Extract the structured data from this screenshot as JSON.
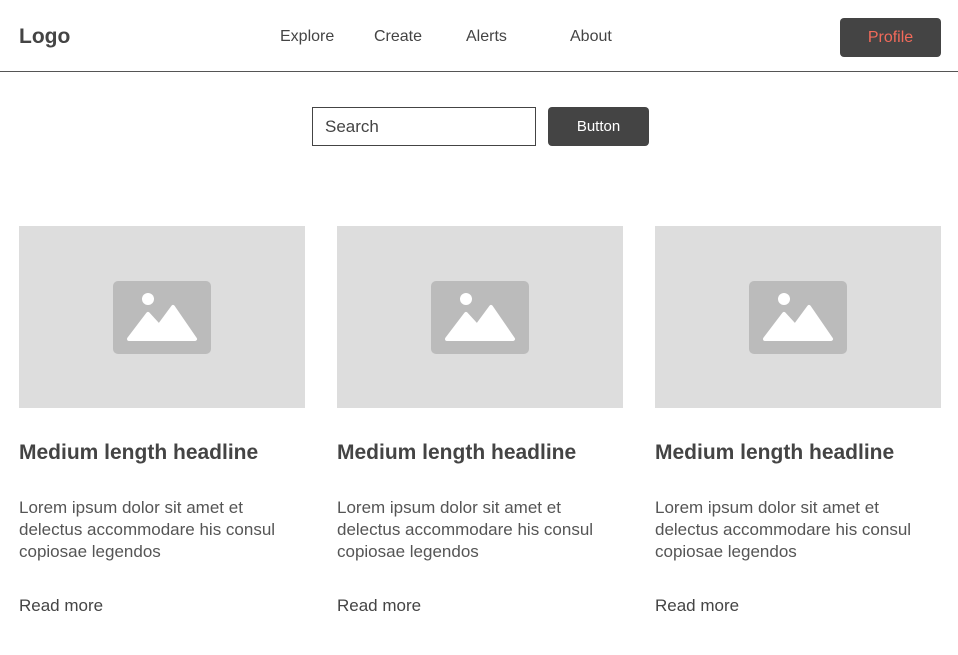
{
  "header": {
    "logo": "Logo",
    "nav": [
      "Explore",
      "Create",
      "Alerts",
      "About"
    ],
    "profile_label": "Profile"
  },
  "search": {
    "placeholder": "Search",
    "button_label": "Button"
  },
  "cards": [
    {
      "title": "Medium length headline",
      "body": "Lorem ipsum dolor sit amet et delectus accommodare his consul copiosae legendos",
      "link": "Read more",
      "image_icon": "image-placeholder-icon"
    },
    {
      "title": "Medium length headline",
      "body": "Lorem ipsum dolor sit amet et delectus accommodare his consul copiosae legendos",
      "link": "Read more",
      "image_icon": "image-placeholder-icon"
    },
    {
      "title": "Medium length headline",
      "body": "Lorem ipsum dolor sit amet et delectus accommodare his consul copiosae legendos",
      "link": "Read more",
      "image_icon": "image-placeholder-icon"
    }
  ],
  "colors": {
    "dark": "#444444",
    "profile_text": "#f26a5a",
    "image_bg": "#dddddd",
    "icon": "#bbbbbb"
  }
}
